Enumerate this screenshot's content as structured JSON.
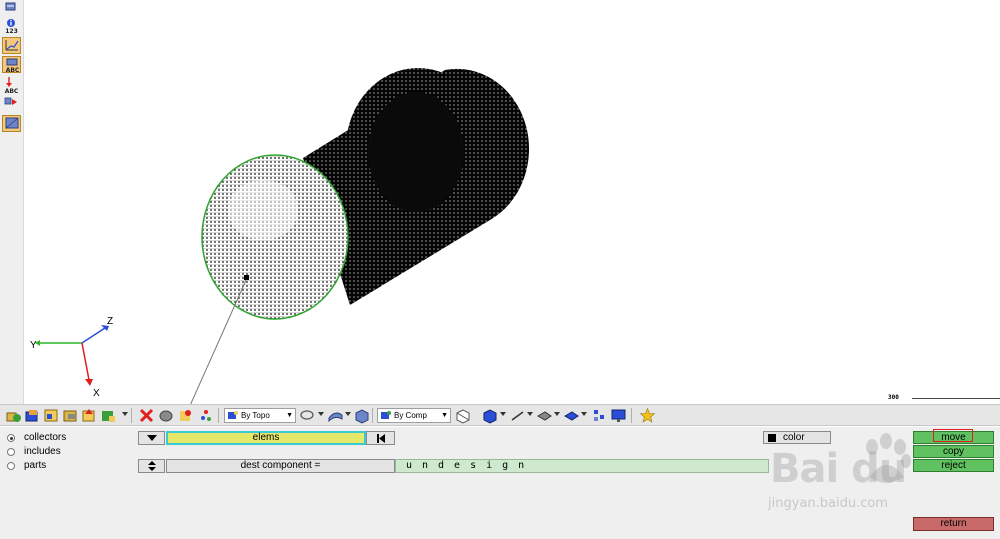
{
  "left_toolbar": {
    "icons": [
      "tape-measure-icon",
      "info-icon",
      "numbers-icon",
      "plot-curve-icon",
      "label-abc-icon",
      "arrow-abc-icon",
      "swap-icon",
      "panel-icon"
    ],
    "captions": {
      "numbers": "123",
      "label": "ABC",
      "arrow": "ABC"
    }
  },
  "graphics": {
    "axes": {
      "x": "X",
      "y": "Y",
      "z": "Z"
    },
    "scale_label": "300",
    "colors": {
      "x_axis": "#e0202a",
      "y_axis": "#2ab52a",
      "z_axis": "#2a4fd6",
      "mesh": "#000000",
      "edge": "#2fa52f"
    }
  },
  "toolbar": {
    "topo_mode": "By Topo",
    "comp_mode": "By Comp"
  },
  "panel": {
    "radios": [
      {
        "label": "collectors",
        "selected": true
      },
      {
        "label": "includes",
        "selected": false
      },
      {
        "label": "parts",
        "selected": false
      }
    ],
    "selector_label": "elems",
    "dest_label": "dest component =",
    "dest_value": "undesign",
    "color_label": "color",
    "actions": {
      "move": "move",
      "copy": "copy",
      "reject": "reject",
      "return": "return"
    },
    "colors": {
      "selector_fill": "#e6e86a",
      "selector_border": "#3cc9d6",
      "dest_fill": "#cfe9cf",
      "action_green": "#5fc15f",
      "return_red": "#c86a6a",
      "highlight": "#e02020"
    }
  },
  "watermark": {
    "brand": "Bai du",
    "url": "jingyan.baidu.com"
  }
}
